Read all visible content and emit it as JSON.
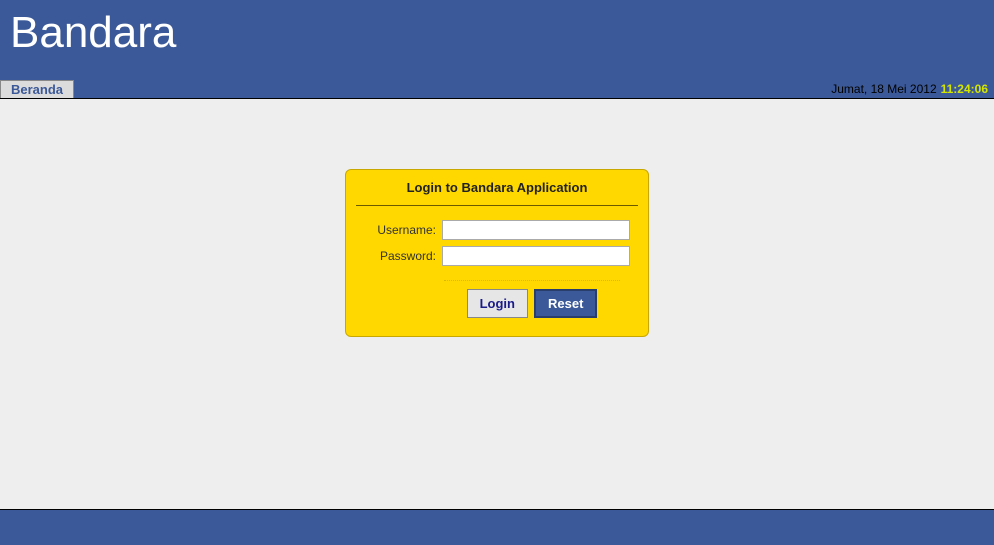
{
  "header": {
    "title": "Bandara"
  },
  "nav": {
    "tab_label": "Beranda"
  },
  "datetime": {
    "date": "Jumat, 18 Mei 2012",
    "time": "11:24:06"
  },
  "login": {
    "title": "Login to Bandara Application",
    "username_label": "Username:",
    "password_label": "Password:",
    "username_value": "",
    "password_value": "",
    "login_button": "Login",
    "reset_button": "Reset"
  }
}
